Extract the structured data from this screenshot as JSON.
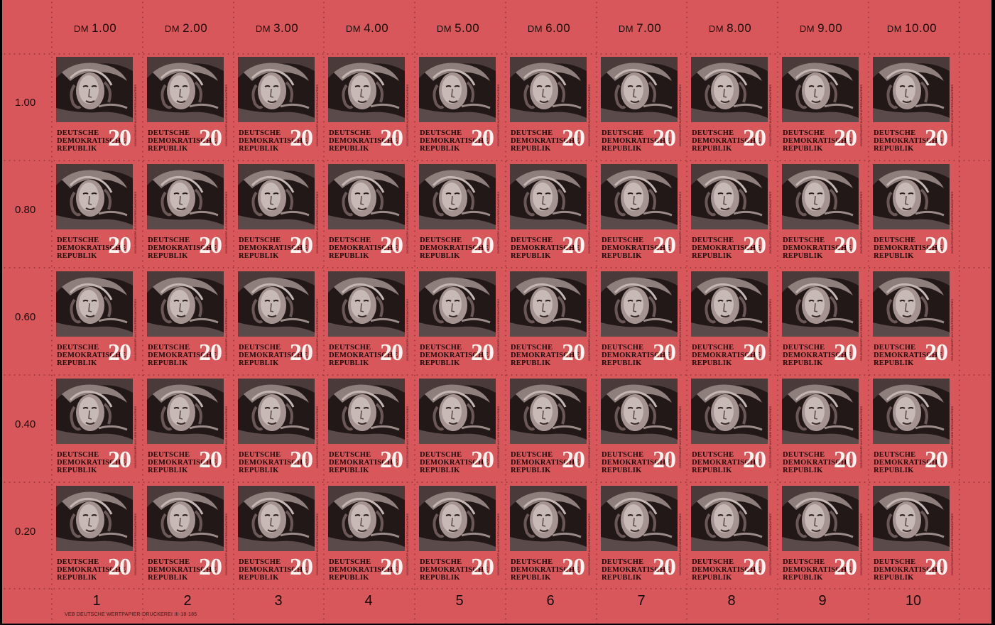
{
  "sheet": {
    "column_values": [
      {
        "dm": "DM",
        "amount": "1.00"
      },
      {
        "dm": "DM",
        "amount": "2.00"
      },
      {
        "dm": "DM",
        "amount": "3.00"
      },
      {
        "dm": "DM",
        "amount": "4.00"
      },
      {
        "dm": "DM",
        "amount": "5.00"
      },
      {
        "dm": "DM",
        "amount": "6.00"
      },
      {
        "dm": "DM",
        "amount": "7.00"
      },
      {
        "dm": "DM",
        "amount": "8.00"
      },
      {
        "dm": "DM",
        "amount": "9.00"
      },
      {
        "dm": "DM",
        "amount": "10.00"
      }
    ],
    "row_values": [
      "1.00",
      "0.80",
      "0.60",
      "0.40",
      "0.20"
    ],
    "column_numbers": [
      "1",
      "2",
      "3",
      "4",
      "5",
      "6",
      "7",
      "8",
      "9",
      "10"
    ],
    "imprint": "VEB DEUTSCHE WERTPAPIER-DRUCKEREI III-18-185"
  },
  "stamp": {
    "country_line1": "DEUTSCHE",
    "country_line2": "DEMOKRATISCHE",
    "country_line3": "REPUBLIK",
    "value": "20",
    "side_text": "GIGANTENKOPF AUS DEM PERGAMONFRIES",
    "rows": 5,
    "columns": 10
  },
  "colors": {
    "sheet_red": "#d8575b",
    "ink_dark": "#1a0808",
    "value_white": "#fff4ef"
  }
}
